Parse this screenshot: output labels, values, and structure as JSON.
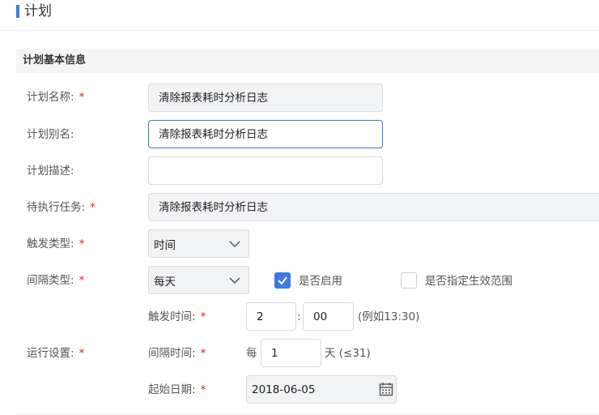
{
  "page": {
    "title": "计划"
  },
  "section": {
    "title": "计划基本信息"
  },
  "required_mark": "*",
  "form": {
    "plan_name": {
      "label": "计划名称:",
      "value": "清除报表耗时分析日志"
    },
    "plan_alias": {
      "label": "计划别名:",
      "value": "清除报表耗时分析日志"
    },
    "plan_desc": {
      "label": "计划描述:",
      "value": ""
    },
    "task": {
      "label": "待执行任务:",
      "value": "清除报表耗时分析日志"
    },
    "trigger_type": {
      "label": "触发类型:",
      "selected": "时间"
    },
    "interval_type": {
      "label": "间隔类型:",
      "selected": "每天"
    },
    "enabled": {
      "label": "是否启用",
      "checked": true
    },
    "range": {
      "label": "是否指定生效范围",
      "checked": false
    },
    "run_settings": {
      "label": "运行设置:"
    },
    "trigger_time": {
      "label": "触发时间:",
      "hour": "2",
      "separator": ":",
      "minute": "00",
      "hint": "(例如13:30)"
    },
    "interval_time": {
      "label": "间隔时间:",
      "prefix": "每",
      "value": "1",
      "suffix": "天 (≤31)"
    },
    "start_date": {
      "label": "起始日期:",
      "value": "2018-06-05"
    }
  },
  "colors": {
    "accent": "#3f78e0",
    "required": "#e02020",
    "disabled_bg": "#f2f3f5"
  }
}
